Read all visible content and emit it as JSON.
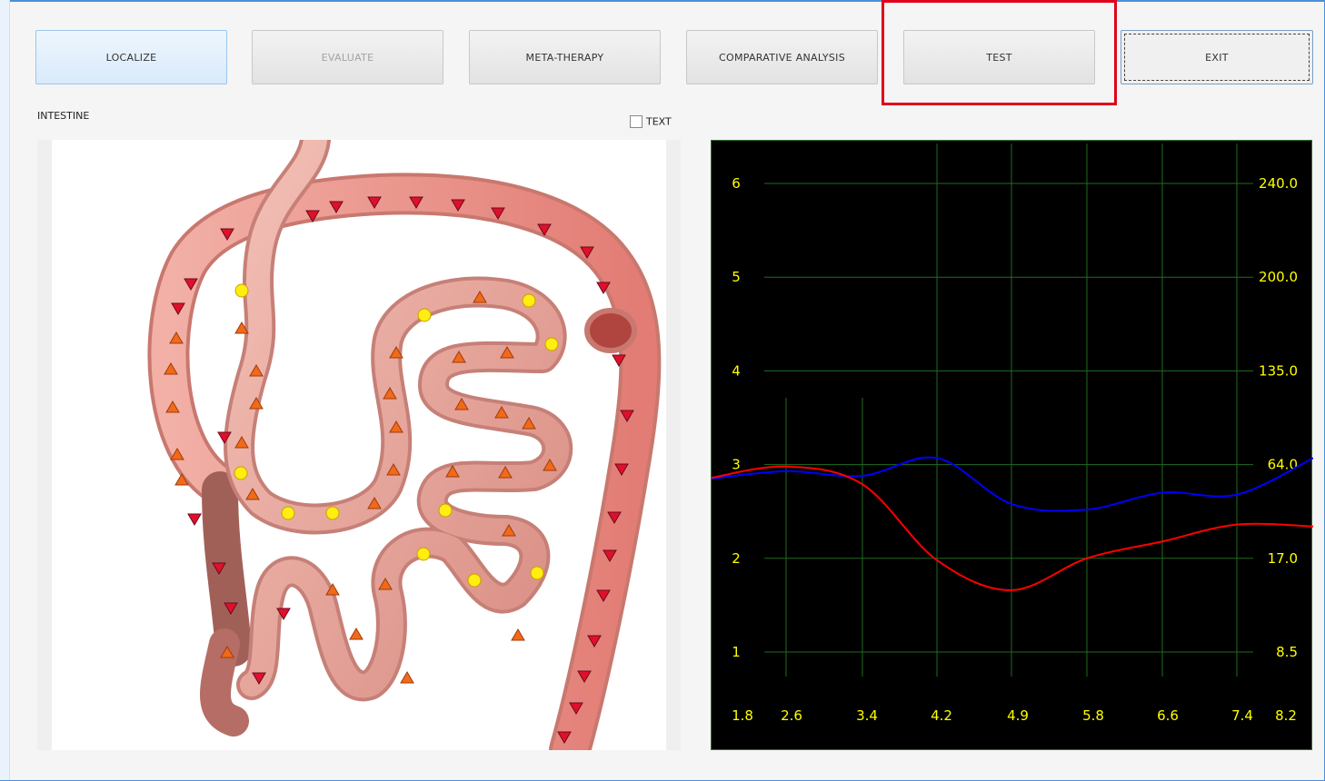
{
  "toolbar": {
    "localize": "LOCALIZE",
    "evaluate": "EVALUATE",
    "meta_therapy": "META-THERAPY",
    "comparative": "COMPARATIVE ANALYSIS",
    "test": "TEST",
    "exit": "EXIT"
  },
  "organ_label": "INTESTINE",
  "text_toggle": {
    "label": "TEXT",
    "checked": false
  },
  "colors": {
    "highlight": "#e0001a",
    "grid": "#1f6b1f",
    "axis_text": "#ffff00",
    "series_blue": "#0000ff",
    "series_red": "#ff0000"
  },
  "chart_data": {
    "type": "line",
    "x_ticks": [
      "1.8",
      "2.6",
      "3.4",
      "4.2",
      "4.9",
      "5.8",
      "6.6",
      "7.4",
      "8.2"
    ],
    "y_left_ticks": [
      "1",
      "2",
      "3",
      "4",
      "5",
      "6"
    ],
    "y_right_ticks": [
      "8.5",
      "17.0",
      "64.0",
      "135.0",
      "200.0",
      "240.0"
    ],
    "ylim": [
      0.8,
      6.0
    ],
    "grid": true,
    "series": [
      {
        "color": "#0000ff",
        "x": [
          1.8,
          2.6,
          3.4,
          4.2,
          4.9,
          5.8,
          6.6,
          7.4,
          8.2
        ],
        "y": [
          2.85,
          2.93,
          2.88,
          3.07,
          2.58,
          2.52,
          2.7,
          2.68,
          3.07
        ]
      },
      {
        "color": "#ff0000",
        "x": [
          1.8,
          2.6,
          3.4,
          4.2,
          4.9,
          5.8,
          6.6,
          7.4,
          8.2
        ],
        "y": [
          2.86,
          2.98,
          2.79,
          1.98,
          1.66,
          2.0,
          2.18,
          2.36,
          2.34
        ]
      }
    ]
  }
}
